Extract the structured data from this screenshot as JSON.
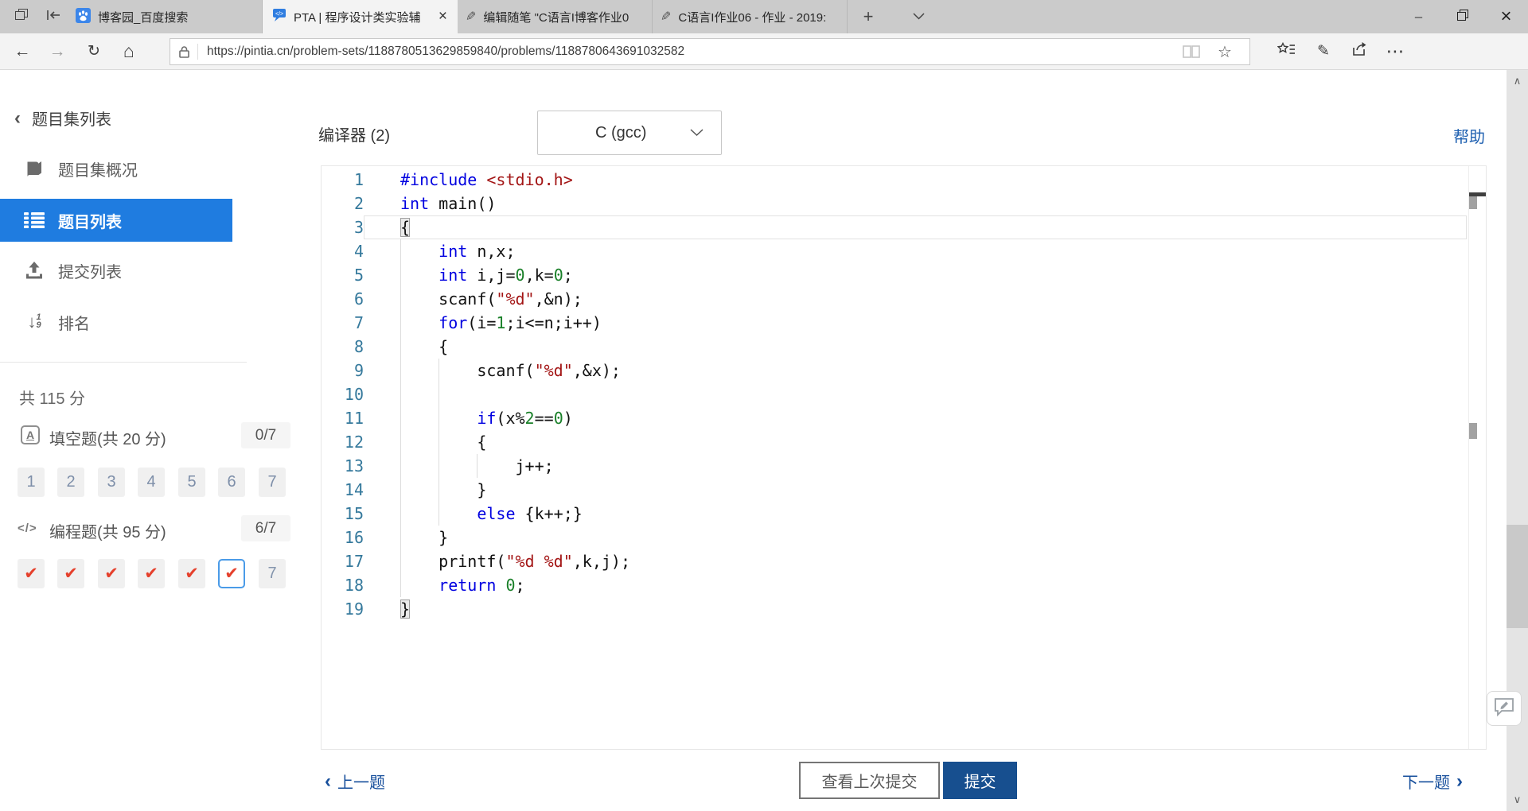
{
  "window": {
    "tab_bar": {
      "tabs": [
        {
          "title": "博客园_百度搜索"
        },
        {
          "title": "PTA | 程序设计类实验辅",
          "close_glyph": "×"
        },
        {
          "title": "编辑随笔 \"C语言I博客作业0"
        },
        {
          "title": "C语言I作业06 - 作业 - 2019:"
        }
      ],
      "new_tab_glyph": "+",
      "window_controls": {
        "minimize_glyph": "─",
        "close_glyph": "×"
      }
    },
    "address_bar": {
      "url": "https://pintia.cn/problem-sets/1188780513629859840/problems/1188780643691032582",
      "back_glyph": "←",
      "forward_glyph": "→",
      "refresh_glyph": "↻",
      "home_glyph": "⌂",
      "star_glyph": "☆",
      "notes_glyph": "✎",
      "more_glyph": "⋯"
    }
  },
  "sidebar": {
    "back_chevron": "‹",
    "back_label": "题目集列表",
    "items": [
      {
        "label": "题目集概况"
      },
      {
        "label": "题目列表"
      },
      {
        "label": "提交列表"
      },
      {
        "label": "排名"
      }
    ],
    "rank_icon": {
      "arrow": "↓",
      "top": "1",
      "bottom": "9"
    },
    "total_score": "共 115 分",
    "fill_section": {
      "icon_letter": "A",
      "label": "填空题(共 20 分)",
      "badge": "0/7",
      "buttons": [
        "1",
        "2",
        "3",
        "4",
        "5",
        "6",
        "7"
      ]
    },
    "code_section": {
      "icon_text": "</>",
      "label": "编程题(共 95 分)",
      "badge": "6/7",
      "check_glyph": "✔",
      "last_label": "7"
    }
  },
  "main": {
    "compiler_label": "编译器 (2)",
    "compiler_value": "C (gcc)",
    "help_label": "帮助",
    "footer": {
      "prev_chevron": "‹",
      "prev_label": "上一题",
      "view_last_label": "查看上次提交",
      "submit_label": "提交",
      "next_label": "下一题",
      "next_chevron": "›"
    }
  },
  "scrollbar": {
    "up_glyph": "∧",
    "down_glyph": "∨"
  },
  "editor": {
    "lines": [
      {
        "n": 1,
        "t": [
          [
            "kw",
            "#include"
          ],
          [
            "pl",
            " "
          ],
          [
            "str",
            "<stdio.h>"
          ]
        ]
      },
      {
        "n": 2,
        "t": [
          [
            "kw",
            "int"
          ],
          [
            "pl",
            " main()"
          ]
        ]
      },
      {
        "n": 3,
        "cur": true,
        "t": [
          [
            "bk",
            "{"
          ]
        ]
      },
      {
        "n": 4,
        "t": [
          [
            "pl",
            "    "
          ],
          [
            "kw",
            "int"
          ],
          [
            "pl",
            " n,x;"
          ]
        ]
      },
      {
        "n": 5,
        "t": [
          [
            "pl",
            "    "
          ],
          [
            "kw",
            "int"
          ],
          [
            "pl",
            " i,j="
          ],
          [
            "num",
            "0"
          ],
          [
            "pl",
            ",k="
          ],
          [
            "num",
            "0"
          ],
          [
            "pl",
            ";"
          ]
        ]
      },
      {
        "n": 6,
        "t": [
          [
            "pl",
            "    scanf("
          ],
          [
            "str",
            "\"%d\""
          ],
          [
            "pl",
            ",&n);"
          ]
        ]
      },
      {
        "n": 7,
        "t": [
          [
            "pl",
            "    "
          ],
          [
            "kw",
            "for"
          ],
          [
            "pl",
            "(i="
          ],
          [
            "num",
            "1"
          ],
          [
            "pl",
            ";i<=n;i++)"
          ]
        ]
      },
      {
        "n": 8,
        "t": [
          [
            "pl",
            "    {"
          ]
        ]
      },
      {
        "n": 9,
        "t": [
          [
            "pl",
            "        scanf("
          ],
          [
            "str",
            "\"%d\""
          ],
          [
            "pl",
            ",&x);"
          ]
        ]
      },
      {
        "n": 10,
        "t": []
      },
      {
        "n": 11,
        "t": [
          [
            "pl",
            "        "
          ],
          [
            "kw",
            "if"
          ],
          [
            "pl",
            "(x%"
          ],
          [
            "num",
            "2"
          ],
          [
            "pl",
            "=="
          ],
          [
            "num",
            "0"
          ],
          [
            "pl",
            ")"
          ]
        ]
      },
      {
        "n": 12,
        "t": [
          [
            "pl",
            "        {"
          ]
        ]
      },
      {
        "n": 13,
        "t": [
          [
            "pl",
            "            j++;"
          ]
        ]
      },
      {
        "n": 14,
        "t": [
          [
            "pl",
            "        }"
          ]
        ]
      },
      {
        "n": 15,
        "t": [
          [
            "pl",
            "        "
          ],
          [
            "kw",
            "else"
          ],
          [
            "pl",
            " {k++;}"
          ]
        ]
      },
      {
        "n": 16,
        "t": [
          [
            "pl",
            "    }"
          ]
        ]
      },
      {
        "n": 17,
        "t": [
          [
            "pl",
            "    printf("
          ],
          [
            "str",
            "\"%d %d\""
          ],
          [
            "pl",
            ",k,j);"
          ]
        ]
      },
      {
        "n": 18,
        "t": [
          [
            "pl",
            "    "
          ],
          [
            "kw",
            "return"
          ],
          [
            "pl",
            " "
          ],
          [
            "num",
            "0"
          ],
          [
            "pl",
            ";"
          ]
        ]
      },
      {
        "n": 19,
        "t": [
          [
            "bk",
            "}"
          ]
        ]
      }
    ]
  },
  "colors": {
    "accent_blue": "#1f7ce0",
    "link_blue": "#174f9c",
    "help_blue": "#1d5fb0",
    "submit_blue": "#174f8f",
    "check_red": "#e5402c",
    "keyword": "#0000e0",
    "string": "#a31515",
    "number": "#1a8029",
    "line_number": "#35799c"
  }
}
